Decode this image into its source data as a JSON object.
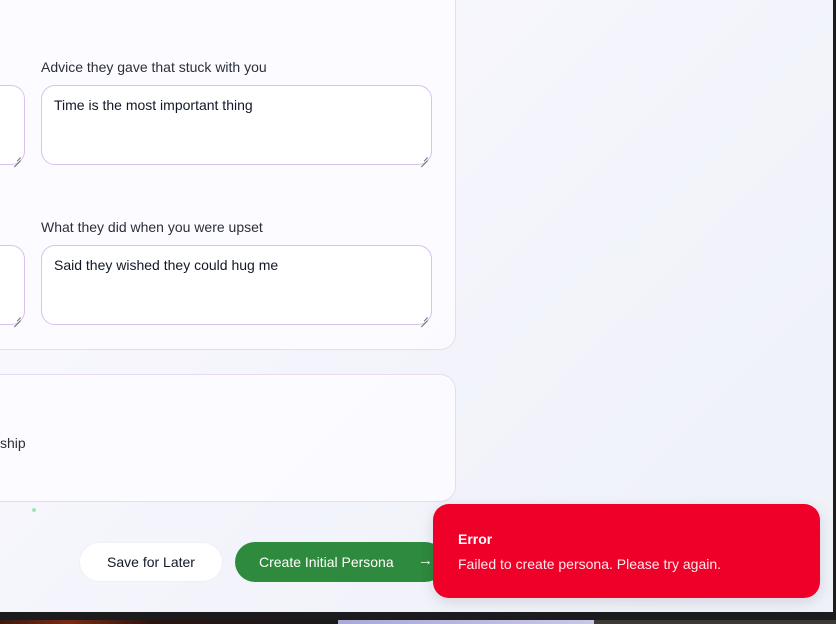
{
  "form": {
    "advice_label": "Advice they gave that stuck with you",
    "advice_value": "Time is the most important thing",
    "upset_label": "What they did when you were upset",
    "upset_value": "Said they wished they could hug me",
    "partial_text": "ship"
  },
  "actions": {
    "save_label": "Save for Later",
    "create_label": "Create Initial Persona",
    "create_icon": "arrow-right-icon"
  },
  "toast": {
    "title": "Error",
    "message": "Failed to create persona. Please try again.",
    "color": "#ef0028"
  },
  "colors": {
    "primary": "#2e8a3c",
    "field_border": "#d9c2ee"
  }
}
